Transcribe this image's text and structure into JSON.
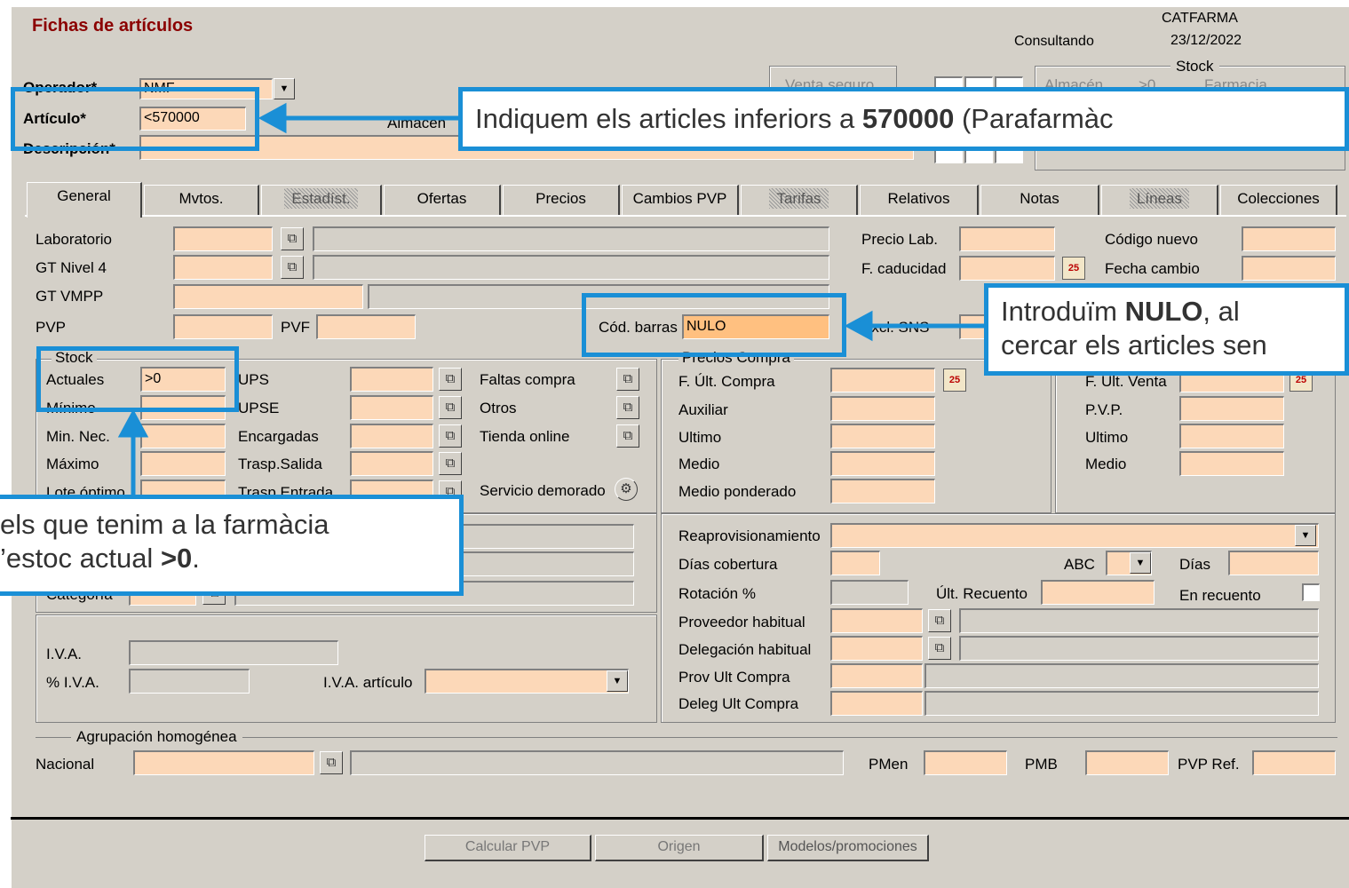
{
  "header": {
    "title": "Fichas de artículos",
    "company": "CATFARMA",
    "date": "23/12/2022",
    "mode": "Consultando"
  },
  "top": {
    "operador_label": "Operador*",
    "operador_value": "NMF",
    "articulo_label": "Artículo*",
    "articulo_value": "<570000",
    "descripcion_label": "Descripción*",
    "almacen_label": "Almacén",
    "venta_seguro": "Venta seguro",
    "stock_group": "Stock",
    "stock_almacen": "Almacén",
    "stock_gt": ">0",
    "stock_farmacia": "Farmacia"
  },
  "tabs": [
    "General",
    "Mvtos.",
    "Estadíst.",
    "Ofertas",
    "Precios",
    "Cambios PVP",
    "Tarifas",
    "Relativos",
    "Notas",
    "Líneas",
    "Colecciones"
  ],
  "general": {
    "laboratorio": "Laboratorio",
    "gt_nivel4": "GT Nivel 4",
    "gt_vmpp": "GT VMPP",
    "pvp": "PVP",
    "pvf": "PVF",
    "cod_barras": "Cód. barras",
    "cod_barras_value": "NULO",
    "precio_lab": "Precio Lab.",
    "f_caducidad": "F. caducidad",
    "excl_sns": "Excl. SNS",
    "codigo_nuevo": "Código nuevo",
    "fecha_cambio": "Fecha cambio"
  },
  "stock": {
    "group": "Stock",
    "actuales": "Actuales",
    "actuales_value": ">0",
    "minimo": "Mínimo",
    "min_nec": "Min. Nec.",
    "maximo": "Máximo",
    "lote": "Lote óptimo",
    "ups": "UPS",
    "upse": "UPSE",
    "encargadas": "Encargadas",
    "trasp_salida": "Trasp.Salida",
    "trasp_entrada": "Trasp.Entrada",
    "faltas": "Faltas compra",
    "otros": "Otros",
    "tienda": "Tienda online",
    "servicio": "Servicio demorado"
  },
  "compra": {
    "group": "Precios Compra",
    "f_ult": "F. Últ. Compra",
    "auxiliar": "Auxiliar",
    "ultimo": "Ultimo",
    "medio": "Medio",
    "ponderado": "Medio ponderado"
  },
  "venta": {
    "f_ult": "F. Últ. Venta",
    "pvp": "P.V.P.",
    "ultimo": "Ultimo",
    "medio": "Medio"
  },
  "left2": {
    "categoria": "Categoría",
    "iva": "I.V.A.",
    "piva": "% I.V.A.",
    "iva_art": "I.V.A. artículo"
  },
  "repo": {
    "reaprov": "Reaprovisionamiento",
    "dias_cob": "Días cobertura",
    "abc": "ABC",
    "dias": "Días",
    "rotacion": "Rotación %",
    "ult_recuento": "Últ. Recuento",
    "en_recuento": "En recuento",
    "prov_hab": "Proveedor habitual",
    "deleg_hab": "Delegación habitual",
    "prov_ult": "Prov Ult Compra",
    "deleg_ult": "Deleg Ult Compra"
  },
  "agrup": {
    "group": "Agrupación homogénea",
    "nacional": "Nacional",
    "pmen": "PMen",
    "pmb": "PMB",
    "pvp_ref": "PVP Ref."
  },
  "buttons": {
    "calcular": "Calcular PVP",
    "origen": "Origen",
    "modelos": "Modelos/promociones"
  },
  "callouts": {
    "c1_pre": "Indiquem els articles inferiors a ",
    "c1_bold": "570000",
    "c1_post": " (Parafarmàc",
    "c2_l1_pre": "Introduïm ",
    "c2_l1_bold": "NULO",
    "c2_l1_post": ", al",
    "c2_l2": "cercar els articles sen",
    "c3_l1": "els que tenim a la farmàcia",
    "c3_l2_pre": "’estoc actual ",
    "c3_l2_bold": ">0",
    "c3_l2_post": "."
  },
  "colors": {
    "field": "#fcd8b8",
    "title": "#8b0000",
    "callout": "#1a8fd6"
  }
}
